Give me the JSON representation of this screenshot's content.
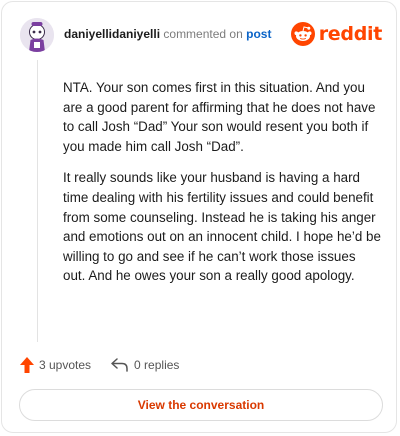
{
  "header": {
    "username": "daniyellidaniyelli",
    "action_text": "commented on",
    "post_link": "post",
    "brand": "reddit"
  },
  "comment": {
    "paragraphs": [
      "NTA. Your son comes first in this situation. And you are a good parent for affirming that he does not have to call Josh “Dad” Your son would resent you both if you made him call Josh “Dad”.",
      "It really sounds like your husband is having a hard time dealing with his fertility issues and could benefit from some counseling. Instead he is taking his anger and emotions out on an innocent child. I hope he’d be willing to go and see if he can’t work those issues out. And he owes your son a really good apology."
    ]
  },
  "actions": {
    "upvotes_label": "3 upvotes",
    "replies_label": "0 replies"
  },
  "cta": {
    "label": "View the conversation"
  },
  "colors": {
    "brand": "#ff4500",
    "upvote": "#ff4500",
    "link": "#0b64c8",
    "cta_text": "#d93900"
  },
  "icons": {
    "avatar": "snoo-avatar",
    "brand": "reddit-snoo-icon",
    "upvote": "upvote-arrow-icon",
    "reply": "reply-arrow-icon"
  }
}
